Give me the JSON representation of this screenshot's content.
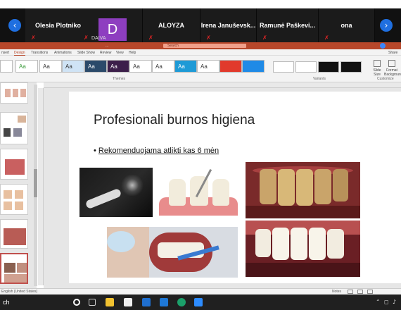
{
  "zoom": {
    "participants": [
      {
        "name": "Olesia Plotnikova"
      },
      {
        "name": "DAIVA",
        "initial": "D"
      },
      {
        "name": "ALOYZA"
      },
      {
        "name": "Irena Januševsk..."
      },
      {
        "name": "Ramunė Paškevi..."
      },
      {
        "name": "ona"
      }
    ],
    "prev_icon": "chevron-left-icon",
    "next_icon": "chevron-right-icon"
  },
  "ppt": {
    "title": "...",
    "search_placeholder": "Search",
    "tabs": [
      "nsert",
      "Design",
      "Transitions",
      "Animations",
      "Slide Show",
      "Review",
      "View",
      "Help"
    ],
    "share": "Share",
    "theme_sample": "Aa",
    "groups": {
      "themes": "Themes",
      "variants": "Variants",
      "customize": "Customize"
    },
    "buttons": {
      "slide_size": "Slide Size",
      "format_background": "Format Background"
    },
    "slide": {
      "title": "Profesionali burnos higiena",
      "bullet": "Rekomenduojama atlikti kas 6 mėn"
    },
    "status_left": "English (United States)",
    "status_notes": "Notes"
  },
  "taskbar": {
    "search_text": "ch"
  },
  "colors": {
    "ppt_accent": "#b7472a",
    "zoom_blue": "#1f6fe0",
    "avatar_purple": "#8e3ec0"
  }
}
